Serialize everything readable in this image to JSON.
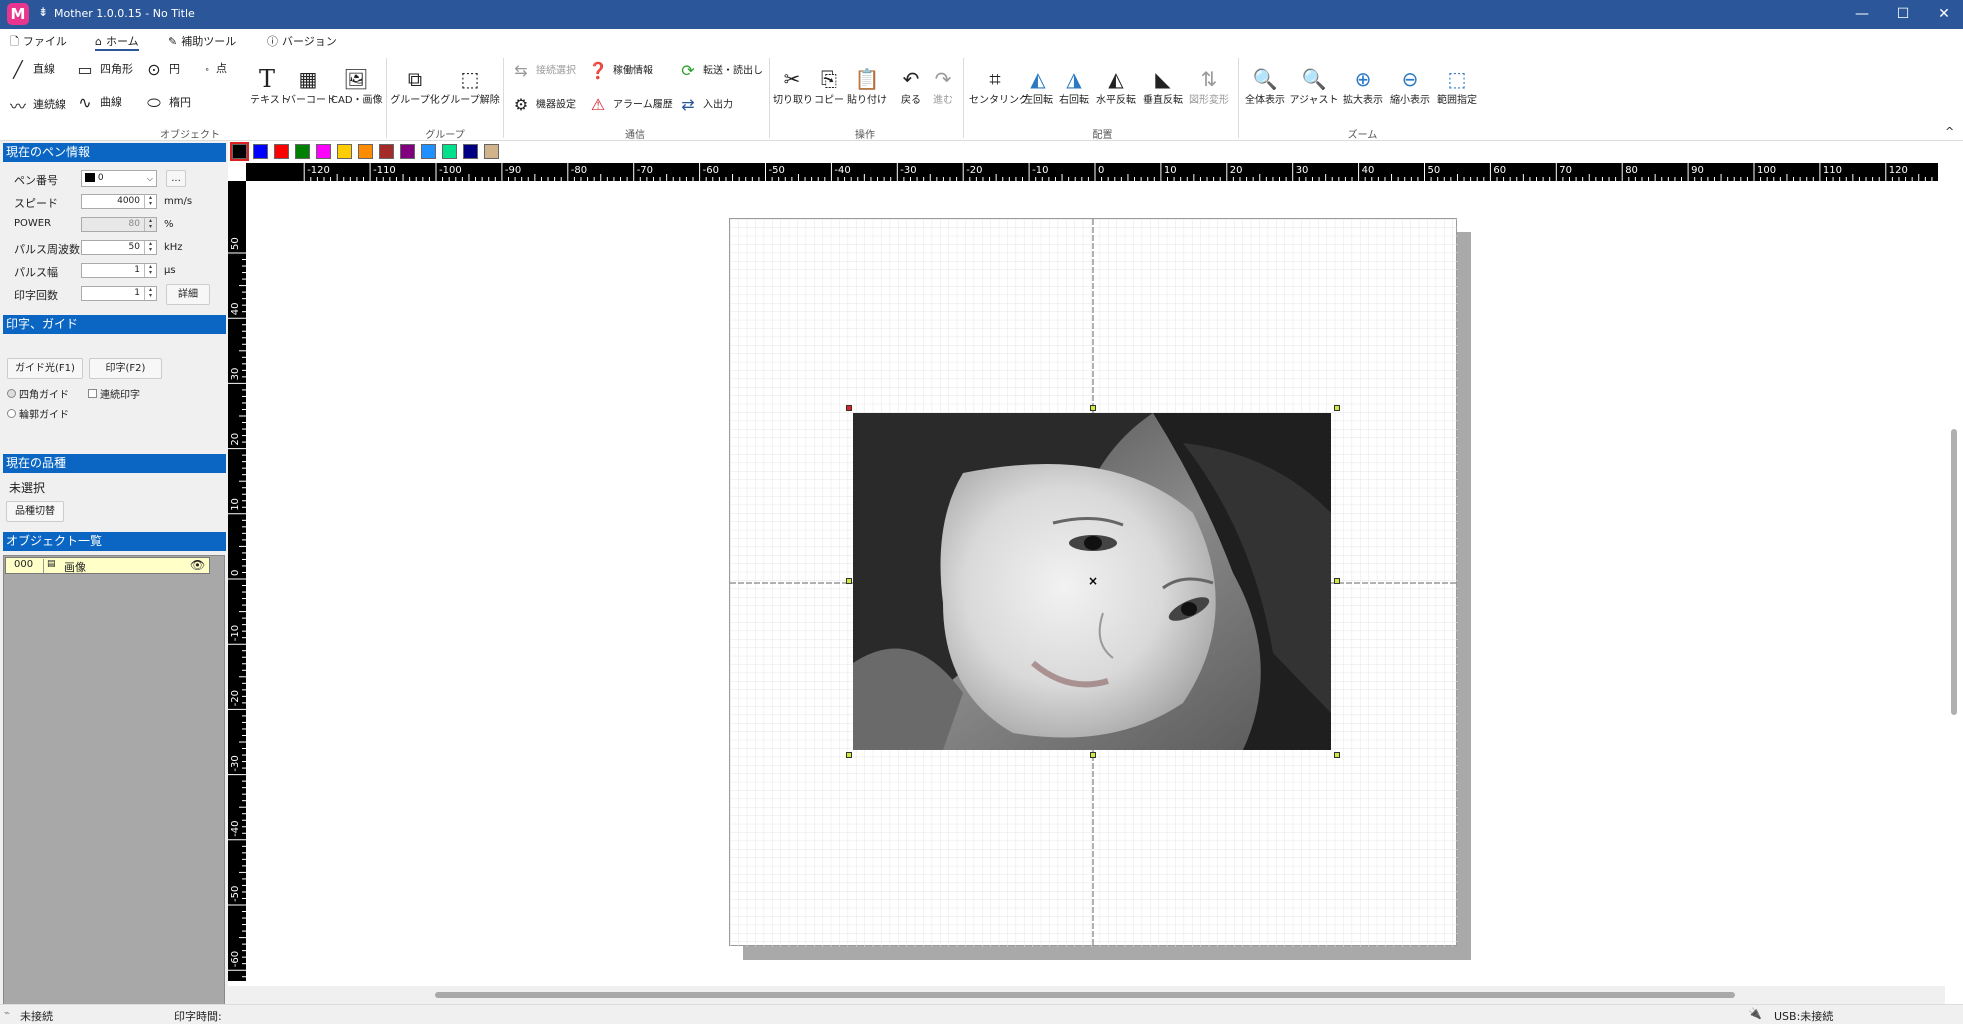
{
  "window": {
    "title": "Mother 1.0.0.15 - No Title",
    "app_icon_letter": "M",
    "qat_symbol": "⇟",
    "minimize": "—",
    "maximize": "☐",
    "close": "✕"
  },
  "tabs": [
    {
      "label": "ファイル",
      "icon": "file-icon",
      "glyph": "🗋"
    },
    {
      "label": "ホーム",
      "icon": "home-icon",
      "glyph": "⌂"
    },
    {
      "label": "補助ツール",
      "icon": "pencil-icon",
      "glyph": "✎"
    },
    {
      "label": "バージョン",
      "icon": "info-icon",
      "glyph": "ⓘ"
    }
  ],
  "ribbon": {
    "object": {
      "line": "直線",
      "rectangle": "四角形",
      "circle": "円",
      "point": "点",
      "polyline": "連続線",
      "curve": "曲線",
      "ellipse": "楕円",
      "text": "テキスト",
      "barcode": "バーコード",
      "cad_image": "CAD・画像",
      "group_label": "オブジェクト"
    },
    "group": {
      "group_btn": "グループ化",
      "ungroup_btn": "グループ解除",
      "group_label": "グループ"
    },
    "comm": {
      "connect_select": "接続選択",
      "operation_info": "稼働情報",
      "transfer": "転送・読出し",
      "device_settings": "機器設定",
      "alarm_history": "アラーム履歴",
      "io": "入出力",
      "group_label": "通信"
    },
    "edit": {
      "cut": "切り取り",
      "copy": "コピー",
      "paste": "貼り付け",
      "undo": "戻る",
      "redo": "進む",
      "group_label": "操作"
    },
    "arrange": {
      "centering": "センタリング",
      "rotate_left": "左回転",
      "rotate_right": "右回転",
      "flip_h": "水平反転",
      "flip_v": "垂直反転",
      "transform": "図形変形",
      "group_label": "配置"
    },
    "zoom": {
      "fit_all": "全体表示",
      "adjust": "アジャスト",
      "zoom_in": "拡大表示",
      "zoom_out": "縮小表示",
      "range": "範囲指定",
      "group_label": "ズーム"
    },
    "collapse": "^"
  },
  "palette": [
    "#000000",
    "#0000ff",
    "#ff0000",
    "#008000",
    "#ff00ff",
    "#ffcc00",
    "#ff8c00",
    "#a52a2a",
    "#800080",
    "#1e90ff",
    "#00e08c",
    "#000080",
    "#d2b48c"
  ],
  "pen": {
    "header": "現在のペン情報",
    "pen_no_label": "ペン番号",
    "pen_no_value": "0",
    "more_btn": "...",
    "speed_label": "スピード",
    "speed_value": "4000",
    "speed_unit": "mm/s",
    "power_label": "POWER",
    "power_value": "80",
    "power_unit": "%",
    "freq_label": "パルス周波数",
    "freq_value": "50",
    "freq_unit": "kHz",
    "width_label": "パルス幅",
    "width_value": "1",
    "width_unit": "μs",
    "count_label": "印字回数",
    "count_value": "1",
    "detail_btn": "詳細"
  },
  "guide": {
    "header": "印字、ガイド",
    "guide_btn": "ガイド光(F1)",
    "print_btn": "印字(F2)",
    "rect_guide": "四角ガイド",
    "continuous": "連続印字",
    "outline_guide": "輪郭ガイド"
  },
  "product": {
    "header": "現在の品種",
    "value": "未選択",
    "switch_btn": "品種切替"
  },
  "objects": {
    "header": "オブジェクト一覧",
    "items": [
      {
        "id": "000",
        "name": "画像"
      }
    ]
  },
  "ruler": {
    "h_ticks": [
      "-120",
      "-110",
      "-100",
      "-90",
      "-80",
      "-70",
      "-60",
      "-50",
      "-40",
      "-30",
      "-20",
      "-10",
      "0",
      "10",
      "20",
      "30",
      "40",
      "50",
      "60",
      "70",
      "80",
      "90",
      "100",
      "110",
      "120"
    ],
    "v_ticks": [
      "50",
      "40",
      "30",
      "20",
      "10",
      "0",
      "-10",
      "-20",
      "-30",
      "-40",
      "-50",
      "-60"
    ]
  },
  "status": {
    "connection": "未接続",
    "print_time": "印字時間:",
    "usb": "USB:未接続"
  }
}
